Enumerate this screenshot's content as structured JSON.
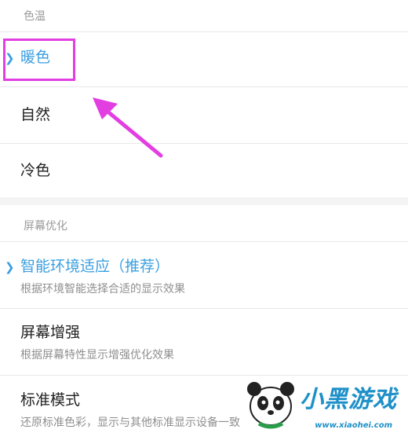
{
  "color_temperature": {
    "header": "色温",
    "options": [
      {
        "label": "暖色",
        "selected": true
      },
      {
        "label": "自然",
        "selected": false
      },
      {
        "label": "冷色",
        "selected": false
      }
    ]
  },
  "screen_optimization": {
    "header": "屏幕优化",
    "options": [
      {
        "label": "智能环境适应（推荐）",
        "description": "根据环境智能选择合适的显示效果",
        "selected": true
      },
      {
        "label": "屏幕增强",
        "description": "根据屏幕特性显示增强优化效果",
        "selected": false
      },
      {
        "label": "标准模式",
        "description": "还原标准色彩，显示与其他标准显示设备一致",
        "selected": false
      }
    ]
  },
  "check_icon": "check-chevron-icon",
  "accent_color": "#3a9fe0",
  "annotation_color": "#e23ee2",
  "watermark": {
    "brand": "小黑游戏",
    "url": "www.xiaohei.com"
  }
}
